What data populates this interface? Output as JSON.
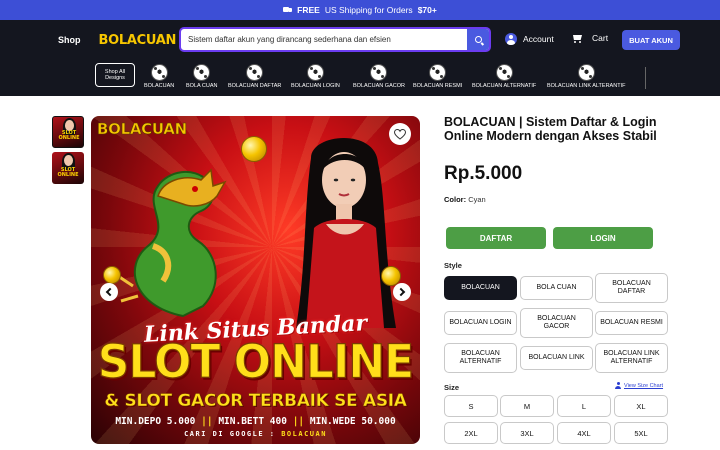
{
  "announcement": {
    "icon": "truck-icon",
    "bold": "FREE",
    "text": "US Shipping for Orders",
    "amount": "$70+"
  },
  "header": {
    "shop_label": "Shop",
    "logo_text": "BOLACUAN",
    "search": {
      "value": "Sistem daftar akun yang dirancang sederhana dan efsien"
    },
    "account_label": "Account",
    "cart_label": "Cart",
    "cta_label": "BUAT AKUN",
    "accent_color": "#4a5ae0"
  },
  "category_nav": {
    "shop_all": "Shop All Designs",
    "items": [
      {
        "label": "BOLACUAN",
        "icon": "soccer-ball-icon"
      },
      {
        "label": "BOLA CUAN",
        "icon": "soccer-ball-icon"
      },
      {
        "label": "BOLACUAN DAFTAR",
        "icon": "soccer-ball-icon"
      },
      {
        "label": "BOLACUAN LOGIN",
        "icon": "soccer-ball-icon"
      },
      {
        "label": "BOLACUAN GACOR",
        "icon": "soccer-ball-icon"
      },
      {
        "label": "BOLACUAN RESMI",
        "icon": "soccer-ball-icon"
      },
      {
        "label": "BOLACUAN ALTERNATIF",
        "icon": "soccer-ball-icon"
      },
      {
        "label": "BOLACUAN LINK ALTERANTIF",
        "icon": "soccer-ball-icon"
      }
    ]
  },
  "gallery": {
    "thumbnails": [
      {
        "alt": "product-image-1",
        "active": true,
        "text": "SLOT ONLINE"
      },
      {
        "alt": "product-image-2",
        "active": false,
        "text": "SLOT ONLINE"
      }
    ],
    "hero": {
      "logo": "BOLACUAN",
      "headline_script": "Link Situs Bandar",
      "headline_main": "SLOT ONLINE",
      "headline_sub": "& SLOT GACOR TERBAIK SE ASIA",
      "promo": {
        "depo": "MIN.DEPO 5.000",
        "bett": "MIN.BETT 400",
        "wede": "MIN.WEDE 50.000",
        "sep": "||"
      },
      "search_hint": "CARI DI GOOGLE :",
      "search_hint_value": "BOLACUAN"
    }
  },
  "product": {
    "title": "BOLACUAN | Sistem Daftar & Login Online Modern dengan Akses Stabil",
    "price": "Rp.5.000",
    "color_label": "Color:",
    "color_value": "Cyan",
    "buttons": {
      "daftar": "DAFTAR",
      "login": "LOGIN"
    },
    "button_color": "#4d9e45",
    "style_label": "Style",
    "styles": [
      {
        "label": "BOLACUAN",
        "selected": true
      },
      {
        "label": "BOLA CUAN",
        "selected": false
      },
      {
        "label": "BOLACUAN DAFTAR",
        "selected": false
      },
      {
        "label": "BOLACUAN LOGIN",
        "selected": false
      },
      {
        "label": "BOLACUAN GACOR",
        "selected": false
      },
      {
        "label": "BOLACUAN RESMI",
        "selected": false
      },
      {
        "label": "BOLACUAN ALTERNATIF",
        "selected": false
      },
      {
        "label": "BOLACUAN LINK",
        "selected": false
      },
      {
        "label": "BOLACUAN LINK ALTERNATIF",
        "selected": false
      }
    ],
    "size_label": "Size",
    "size_chart_label": "View Size Chart",
    "sizes": [
      "S",
      "M",
      "L",
      "XL",
      "2XL",
      "3XL",
      "4XL",
      "5XL"
    ]
  }
}
